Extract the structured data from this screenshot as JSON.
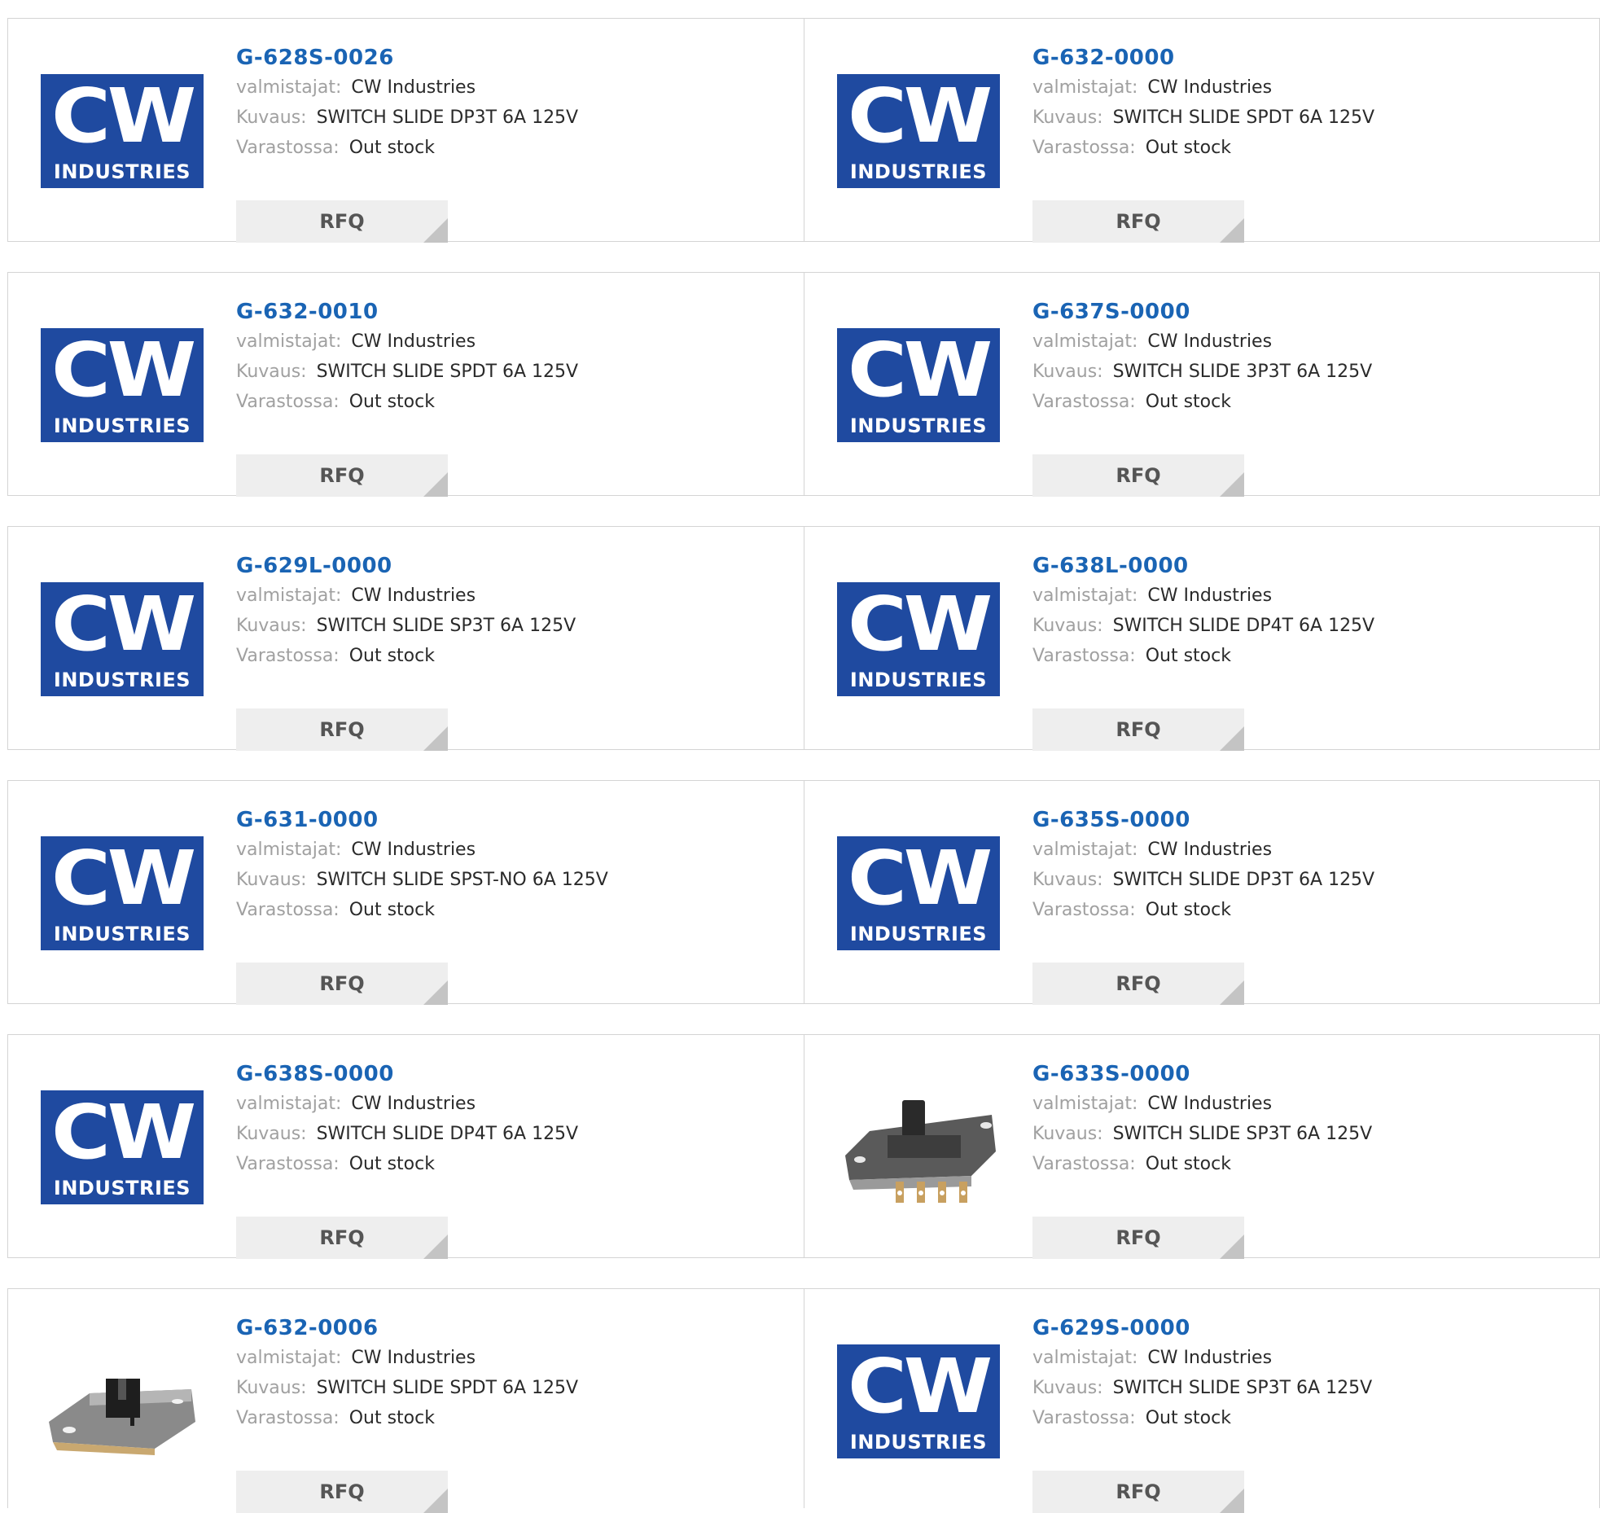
{
  "labels": {
    "manufacturer": "valmistajat:",
    "description": "Kuvaus:",
    "stock": "Varastossa:",
    "rfq": "RFQ"
  },
  "logo": {
    "mark": "CW",
    "word": "INDUSTRIES",
    "color": "#1f4aa0"
  },
  "products": [
    {
      "part": "G-628S-0026",
      "manufacturer": "CW Industries",
      "description": "SWITCH SLIDE DP3T 6A 125V",
      "stock": "Out stock",
      "image": "cw-logo"
    },
    {
      "part": "G-632-0000",
      "manufacturer": "CW Industries",
      "description": "SWITCH SLIDE SPDT 6A 125V",
      "stock": "Out stock",
      "image": "cw-logo"
    },
    {
      "part": "G-632-0010",
      "manufacturer": "CW Industries",
      "description": "SWITCH SLIDE SPDT 6A 125V",
      "stock": "Out stock",
      "image": "cw-logo"
    },
    {
      "part": "G-637S-0000",
      "manufacturer": "CW Industries",
      "description": "SWITCH SLIDE 3P3T 6A 125V",
      "stock": "Out stock",
      "image": "cw-logo"
    },
    {
      "part": "G-629L-0000",
      "manufacturer": "CW Industries",
      "description": "SWITCH SLIDE SP3T 6A 125V",
      "stock": "Out stock",
      "image": "cw-logo"
    },
    {
      "part": "G-638L-0000",
      "manufacturer": "CW Industries",
      "description": "SWITCH SLIDE DP4T 6A 125V",
      "stock": "Out stock",
      "image": "cw-logo"
    },
    {
      "part": "G-631-0000",
      "manufacturer": "CW Industries",
      "description": "SWITCH SLIDE SPST-NO 6A 125V",
      "stock": "Out stock",
      "image": "cw-logo"
    },
    {
      "part": "G-635S-0000",
      "manufacturer": "CW Industries",
      "description": "SWITCH SLIDE DP3T 6A 125V",
      "stock": "Out stock",
      "image": "cw-logo"
    },
    {
      "part": "G-638S-0000",
      "manufacturer": "CW Industries",
      "description": "SWITCH SLIDE DP4T 6A 125V",
      "stock": "Out stock",
      "image": "cw-logo"
    },
    {
      "part": "G-633S-0000",
      "manufacturer": "CW Industries",
      "description": "SWITCH SLIDE SP3T 6A 125V",
      "stock": "Out stock",
      "image": "slide-switch-photo-pins"
    },
    {
      "part": "G-632-0006",
      "manufacturer": "CW Industries",
      "description": "SWITCH SLIDE SPDT 6A 125V",
      "stock": "Out stock",
      "image": "slide-switch-photo"
    },
    {
      "part": "G-629S-0000",
      "manufacturer": "CW Industries",
      "description": "SWITCH SLIDE SP3T 6A 125V",
      "stock": "Out stock",
      "image": "cw-logo"
    }
  ]
}
